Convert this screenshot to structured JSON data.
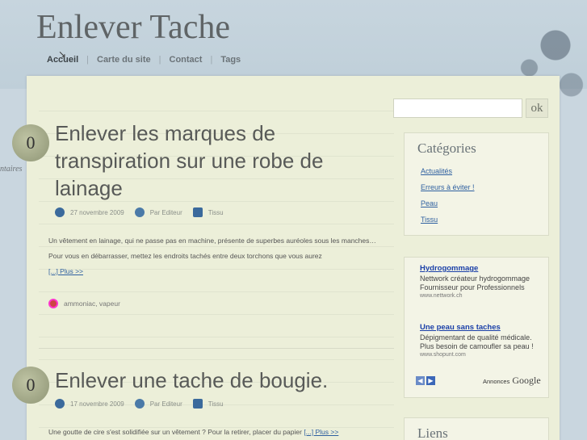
{
  "site": {
    "title": "Enlever Tache"
  },
  "nav": {
    "items": [
      {
        "label": "Accueil"
      },
      {
        "label": "Carte du site"
      },
      {
        "label": "Contact"
      },
      {
        "label": "Tags"
      }
    ],
    "separator": "|"
  },
  "search": {
    "button_label": "ok",
    "value": ""
  },
  "sidebar": {
    "categories": {
      "title": "Catégories",
      "items": [
        "Actualités",
        "Erreurs à éviter !",
        "Peau",
        "Tissu"
      ]
    },
    "ads": {
      "items": [
        {
          "title": "Hydrogommage",
          "text": "Nettwork créateur hydrogommage Fournisseur pour Professionnels",
          "url": "www.nettwork.ch"
        },
        {
          "title": "Une peau sans taches",
          "text": "Dépigmentant de qualité médicale. Plus besoin de camoufler sa peau !",
          "url": "www.shopunt.com"
        }
      ],
      "nav_prev": "◀",
      "nav_next": "▶",
      "brand_prefix": "Annonces",
      "brand_name": "Google"
    },
    "links": {
      "title": "Liens"
    }
  },
  "posts": [
    {
      "comments": "0",
      "comments_note": "ntaires",
      "title": "Enlever les marques de transpiration sur une robe de lainage",
      "date": "27 novembre 2009",
      "author": "Par Editeur",
      "category": "Tissu",
      "excerpt": "Un vêtement en lainage, qui ne passe pas en machine, présente de superbes auréoles sous les manches… Pour vous en débarrasser, mettez les endroits tachés entre deux torchons que vous aurez",
      "more": "[...] Plus >>",
      "tags": "ammoniac, vapeur"
    },
    {
      "comments": "0",
      "title": "Enlever une tache de bougie.",
      "date": "17 novembre 2009",
      "author": "Par Editeur",
      "category": "Tissu",
      "excerpt": "Une goutte de cire s'est solidifiée sur un vêtement ? Pour la retirer, placer du papier",
      "more": "[...] Plus >>"
    }
  ]
}
